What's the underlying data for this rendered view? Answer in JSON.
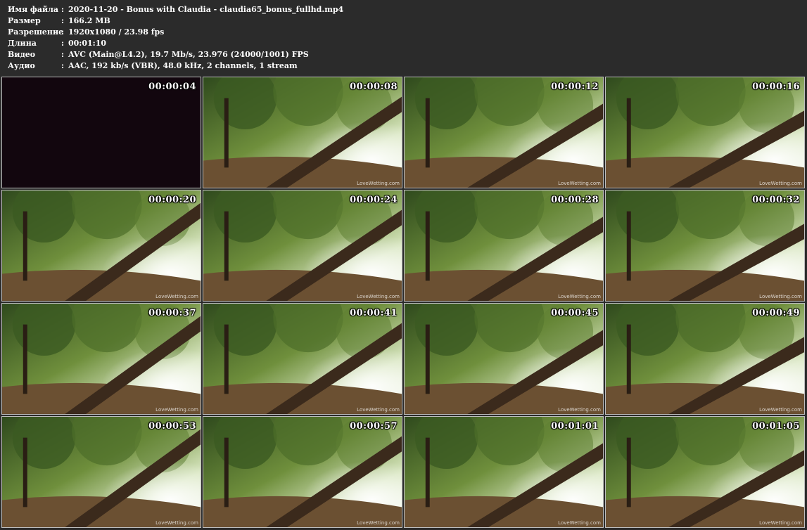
{
  "info": [
    {
      "label": "Имя файла",
      "sep": ":",
      "value": "2020-11-20 - Bonus with Claudia - claudia65_bonus_fullhd.mp4"
    },
    {
      "label": "Размер",
      "sep": ":",
      "value": "166.2 MB"
    },
    {
      "label": "Разрешение",
      "sep": ":",
      "value": "1920x1080 / 23.98 fps"
    },
    {
      "label": "Длина",
      "sep": ":",
      "value": "00:01:10"
    },
    {
      "label": "Видео",
      "sep": ":",
      "value": "AVC (Main@L4.2), 19.7 Mb/s, 23.976 (24000/1001) FPS"
    },
    {
      "label": "Аудио",
      "sep": ":",
      "value": "AAC, 192 kb/s (VBR), 48.0 kHz, 2 channels, 1 stream"
    }
  ],
  "watermark": "LoveWetting.com",
  "thumbnails": [
    {
      "time": "00:00:04",
      "dark": true
    },
    {
      "time": "00:00:08"
    },
    {
      "time": "00:00:12"
    },
    {
      "time": "00:00:16"
    },
    {
      "time": "00:00:20"
    },
    {
      "time": "00:00:24"
    },
    {
      "time": "00:00:28"
    },
    {
      "time": "00:00:32"
    },
    {
      "time": "00:00:37"
    },
    {
      "time": "00:00:41"
    },
    {
      "time": "00:00:45"
    },
    {
      "time": "00:00:49"
    },
    {
      "time": "00:00:53"
    },
    {
      "time": "00:00:57"
    },
    {
      "time": "00:01:01"
    },
    {
      "time": "00:01:05"
    }
  ]
}
